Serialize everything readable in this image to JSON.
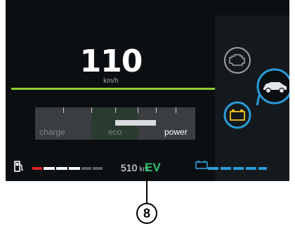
{
  "speed": {
    "value": "110",
    "unit": "km/h"
  },
  "power_gauge": {
    "labels": [
      "charge",
      "eco",
      "power"
    ],
    "active_label": "power"
  },
  "fuel": {
    "level_fraction": 0.55
  },
  "range": {
    "value": "510",
    "unit": "km"
  },
  "drive_mode": "EV",
  "battery": {
    "level_fraction": 0.9
  },
  "callout": {
    "number": "8"
  },
  "colors": {
    "accent_green": "#8fcc2a",
    "ev_green": "#2ec46a",
    "battery_blue": "#2a9bd8",
    "fuel_red": "#d9262c"
  },
  "icons": [
    "fuel-pump-icon",
    "battery-icon",
    "engine-icon",
    "car-icon",
    "battery-warning-icon"
  ]
}
